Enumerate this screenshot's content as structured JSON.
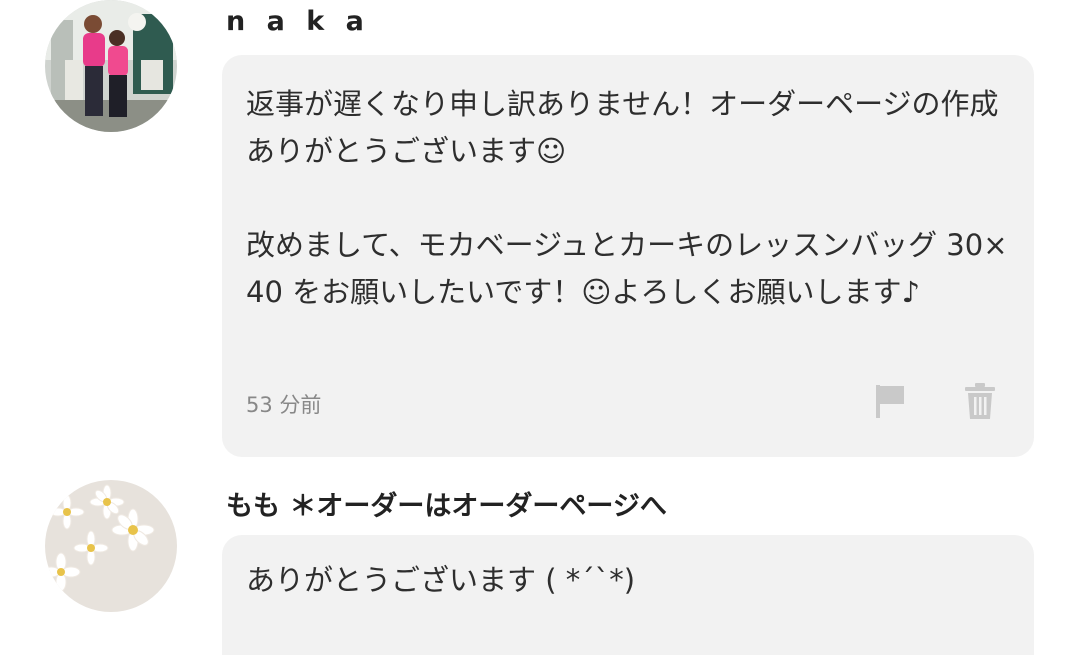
{
  "messages": [
    {
      "username": "n a k a",
      "text": "返事が遅くなり申し訳ありません！オーダーページの作成ありがとうございます☺\n\n改めまして、モカベージュとカーキのレッスンバッグ 30×40 をお願いしたいです！☺よろしくお願いします♪",
      "timestamp": "53 分前",
      "actions": {
        "flag_icon": "flag-icon",
        "trash_icon": "trash-icon"
      }
    },
    {
      "username": "もも ＊オーダーはオーダーページへ",
      "text": "ありがとうございます ( *´`*)"
    }
  ],
  "colors": {
    "bubble_bg": "#f2f2f2",
    "text": "#2e2e2e",
    "muted": "#888888",
    "icon": "#c9c9c9"
  }
}
